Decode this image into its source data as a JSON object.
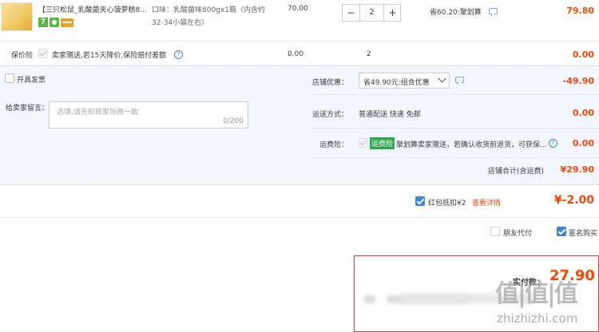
{
  "item": {
    "title": "【三只松鼠_乳酸菌夹心菠萝糕8...",
    "badge_7": "7",
    "sku_label": "口味：乳酸菌味800gx1箱（内含约32-34小袋左右）",
    "price": "70.00",
    "quantity": "2",
    "minus": "−",
    "plus": "+",
    "save_text": "省60.20:聚划算",
    "subtotal": "79.80"
  },
  "insurance": {
    "label": "保价险",
    "desc": "卖家赠送,若15天降价,保险赔付差额",
    "help": "?",
    "price": "0.00",
    "qty": "2",
    "total": "0.00"
  },
  "invoice": {
    "label": "开具发票"
  },
  "shop_discount": {
    "label": "店铺优惠：",
    "selected": "省49.90元:组合优惠",
    "amount": "-49.90"
  },
  "message": {
    "label": "给卖家留言：",
    "placeholder": "选填,请先和商家协商一致",
    "counter": "0/200"
  },
  "shipping": {
    "label": "运送方式：",
    "value": "普通配送 快递 免邮",
    "amount": "0.00"
  },
  "freight": {
    "label": "运费险：",
    "badge": "运费险",
    "desc": "聚划算卖家赠送，若确认收货前退货，可获保...",
    "amount": "0.00"
  },
  "store_total": {
    "label": "店铺合计(含运费)",
    "amount": "¥29.90"
  },
  "red_packet": {
    "label": "红包抵扣¥2",
    "link": "查看详情",
    "amount": "¥-2.00"
  },
  "options": {
    "friend_pay": "朋友代付",
    "anonymous": "匿名购买"
  },
  "pay": {
    "label": "实付款：",
    "amount": "27.90"
  },
  "watermark": {
    "text": "值|值|值",
    "url": "zhizhizhi.com"
  },
  "colors": {
    "accent": "#f40",
    "blue": "#3d84d6",
    "panel": "#f2f7ff",
    "border": "#b8d3f0"
  }
}
